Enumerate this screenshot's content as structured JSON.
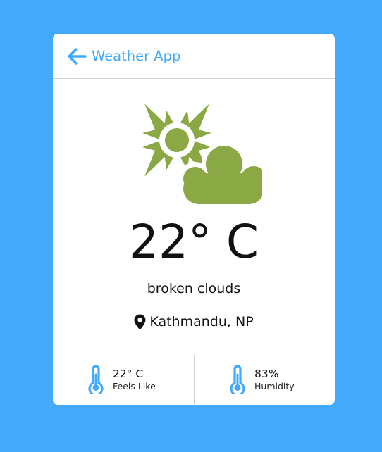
{
  "header": {
    "title": "Weather App",
    "back_icon": "arrow-left-icon"
  },
  "weather": {
    "icon": "sun-behind-cloud-icon",
    "temperature": "22° C",
    "description": "broken clouds",
    "location_icon": "map-pin-icon",
    "location": "Kathmandu, NP"
  },
  "details": {
    "feels_like": {
      "icon": "thermometer-icon",
      "value": "22° C",
      "label": "Feels Like"
    },
    "humidity": {
      "icon": "thermometer-icon",
      "value": "83%",
      "label": "Humidity"
    }
  },
  "colors": {
    "background": "#43aafb",
    "accent": "#43aafb",
    "icon_green": "#8aa844",
    "card": "#ffffff"
  }
}
